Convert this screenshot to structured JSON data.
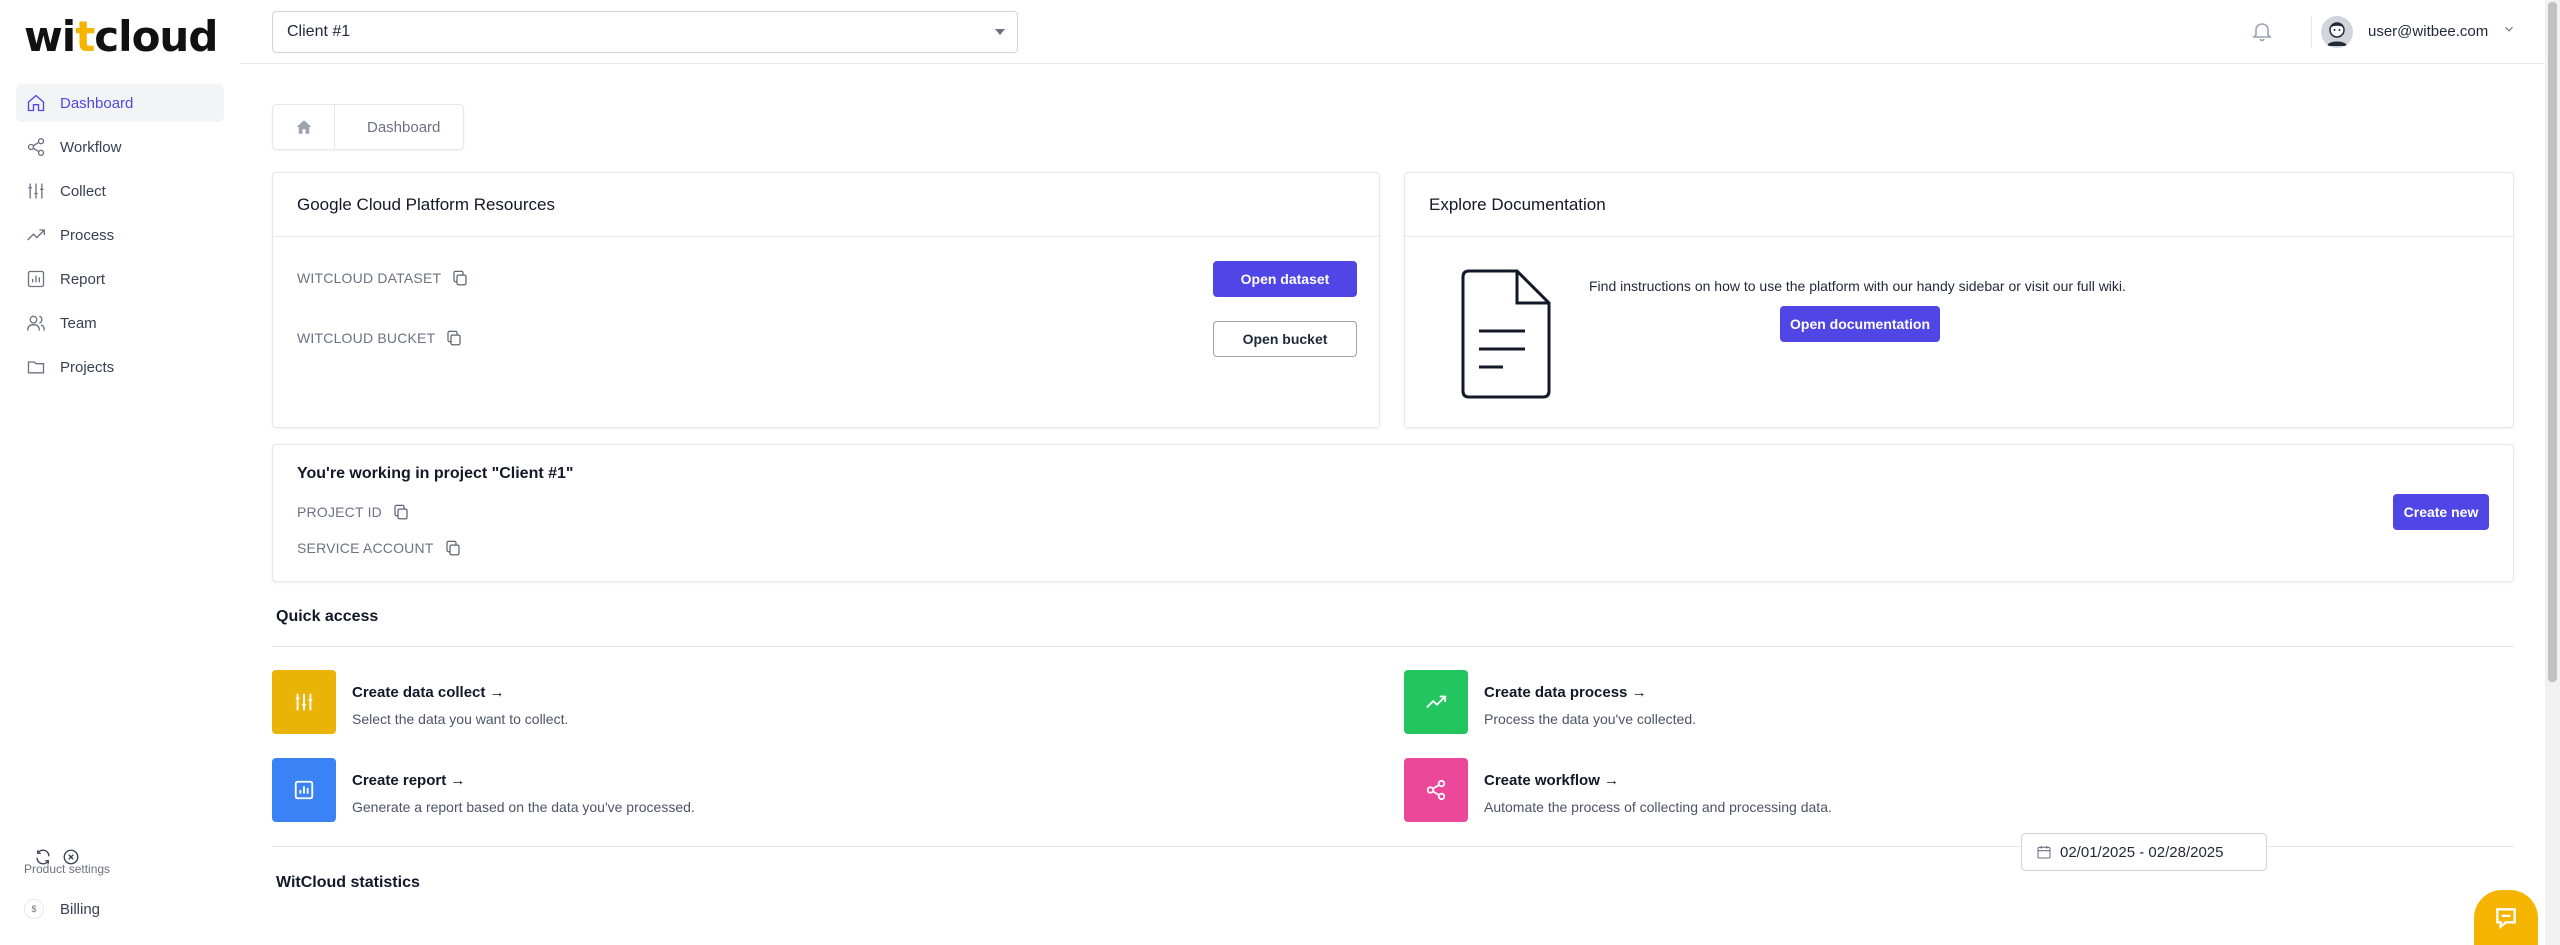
{
  "brand": {
    "logo_prefix": "wi",
    "logo_accent": "t",
    "logo_suffix": "cloud"
  },
  "header": {
    "client_select_value": "Client #1",
    "user_email": "user@witbee.com"
  },
  "sidebar": {
    "items": [
      {
        "label": "Dashboard",
        "icon": "home-icon",
        "active": true
      },
      {
        "label": "Workflow",
        "icon": "share-icon"
      },
      {
        "label": "Collect",
        "icon": "sliders-icon"
      },
      {
        "label": "Process",
        "icon": "trending-up-icon"
      },
      {
        "label": "Report",
        "icon": "chart-icon"
      },
      {
        "label": "Team",
        "icon": "users-icon"
      },
      {
        "label": "Projects",
        "icon": "folder-icon"
      }
    ],
    "settings_title": "Product settings",
    "billing_label": "Billing"
  },
  "breadcrumb": {
    "current": "Dashboard"
  },
  "gcp": {
    "title": "Google Cloud Platform Resources",
    "dataset_label": "WITCLOUD DATASET",
    "bucket_label": "WITCLOUD BUCKET",
    "open_dataset": "Open dataset",
    "open_bucket": "Open bucket"
  },
  "docs": {
    "title": "Explore Documentation",
    "text": "Find instructions on how to use the platform with our handy sidebar or visit our full wiki.",
    "button": "Open documentation"
  },
  "project": {
    "title": "You're working in project \"Client #1\"",
    "project_id_label": "PROJECT ID",
    "service_account_label": "SERVICE ACCOUNT",
    "create_new": "Create new"
  },
  "quick_access": {
    "title": "Quick access",
    "items": [
      {
        "title": "Create data collect →",
        "desc": "Select the data you want to collect.",
        "color": "#eab308",
        "icon": "sliders-icon"
      },
      {
        "title": "Create data process →",
        "desc": "Process the data you've collected.",
        "color": "#22c55e",
        "icon": "trending-up-icon"
      },
      {
        "title": "Create report →",
        "desc": "Generate a report based on the data you've processed.",
        "color": "#3b82f6",
        "icon": "chart-icon"
      },
      {
        "title": "Create workflow →",
        "desc": "Automate the process of collecting and processing data.",
        "color": "#ec4899",
        "icon": "share-icon"
      }
    ]
  },
  "statistics": {
    "title": "WitCloud statistics",
    "date_range": "02/01/2025 - 02/28/2025"
  },
  "colors": {
    "primary": "#4f46e5",
    "accent": "#f5b400"
  }
}
